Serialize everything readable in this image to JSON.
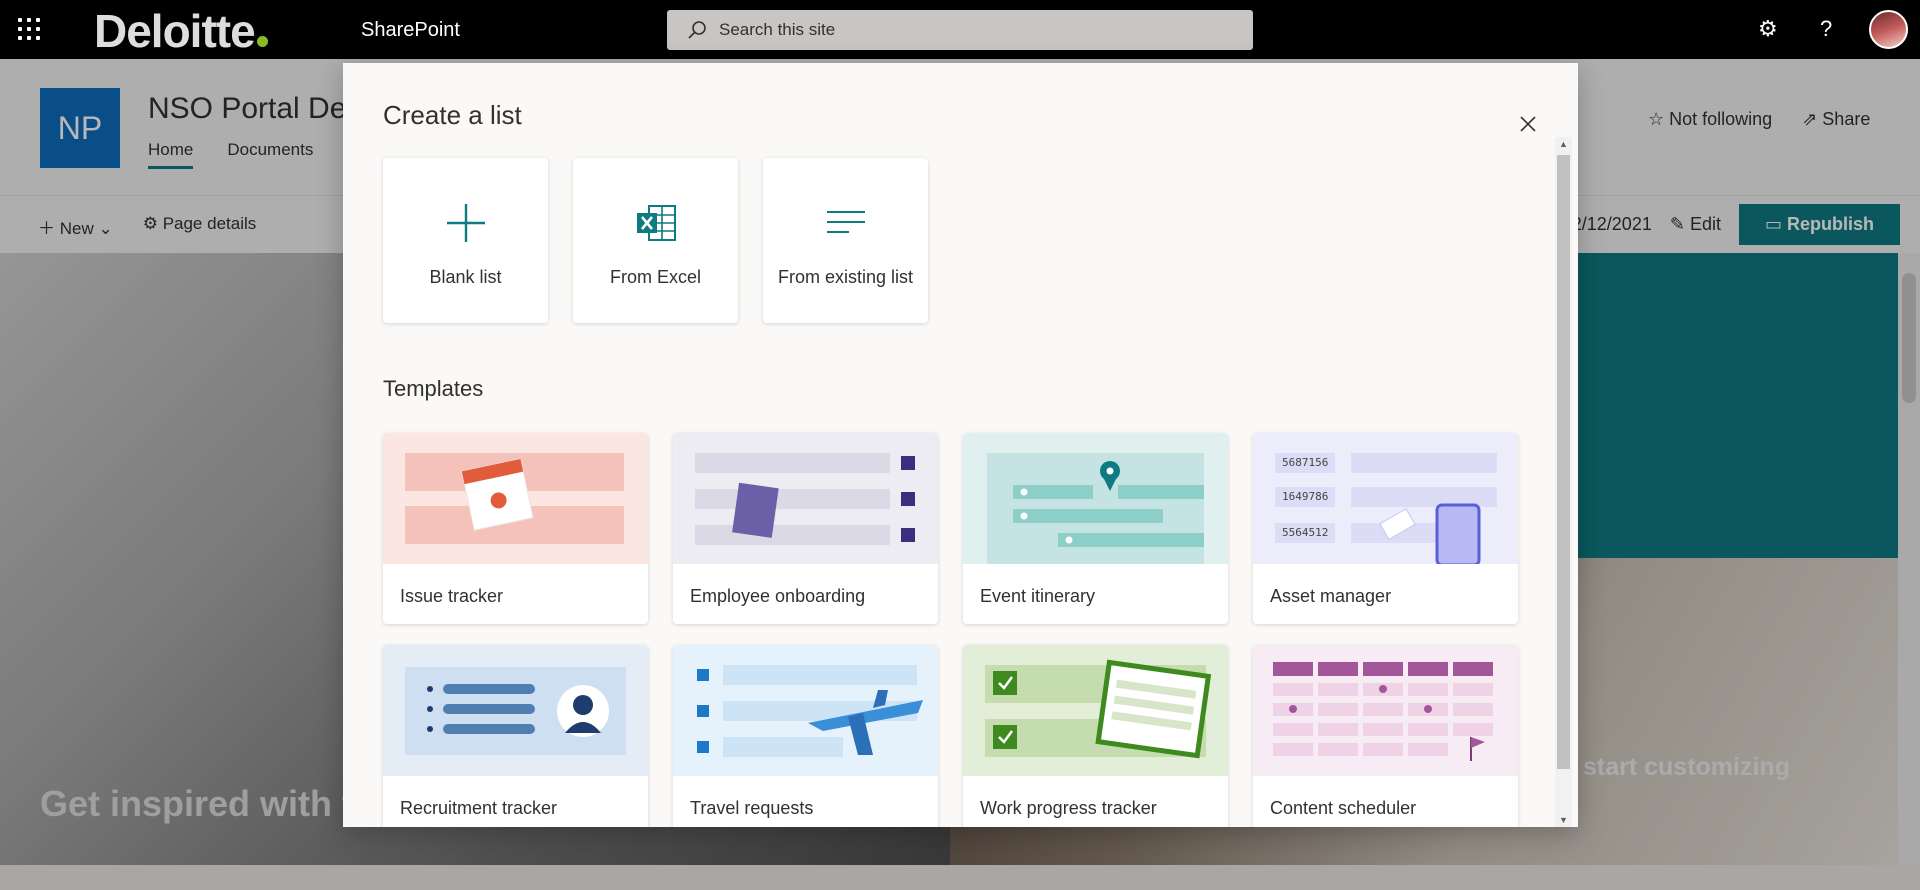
{
  "suite": {
    "logo_text": "Deloitte",
    "app_name": "SharePoint",
    "search_placeholder": "Search this site",
    "icons": [
      "waffle-icon",
      "search-icon",
      "gear-icon",
      "help-icon",
      "avatar"
    ]
  },
  "site": {
    "initials": "NP",
    "title": "NSO Portal De",
    "nav": [
      "Home",
      "Documents"
    ],
    "follow_label": "Not following",
    "share_label": "Share"
  },
  "commandbar": {
    "new_label": "New",
    "page_details_label": "Page details",
    "date_fragment": "2/12/2021",
    "edit_label": "Edit",
    "republish_label": "Republish"
  },
  "hero": {
    "left_text": "Get inspired with th",
    "right_text": "start customizing"
  },
  "modal": {
    "title": "Create a list",
    "create_options": [
      {
        "label": "Blank list",
        "icon": "plus-icon"
      },
      {
        "label": "From Excel",
        "icon": "excel-icon"
      },
      {
        "label": "From existing list",
        "icon": "lines-icon"
      }
    ],
    "templates_heading": "Templates",
    "templates": [
      {
        "label": "Issue tracker",
        "bg": "#fbe6e2"
      },
      {
        "label": "Employee onboarding",
        "bg": "#eeecf3"
      },
      {
        "label": "Event itinerary",
        "bg": "#dff0ef"
      },
      {
        "label": "Asset manager",
        "bg": "#ececfb"
      },
      {
        "label": "Recruitment tracker",
        "bg": "#e4edf5"
      },
      {
        "label": "Travel requests",
        "bg": "#e5f1fb"
      },
      {
        "label": "Work progress tracker",
        "bg": "#e2eed8"
      },
      {
        "label": "Content scheduler",
        "bg": "#f8ecf4"
      }
    ]
  },
  "colors": {
    "accent": "#0e7a82",
    "brand_blue": "#0f6cbd",
    "deloitte_green": "#86bc25"
  }
}
